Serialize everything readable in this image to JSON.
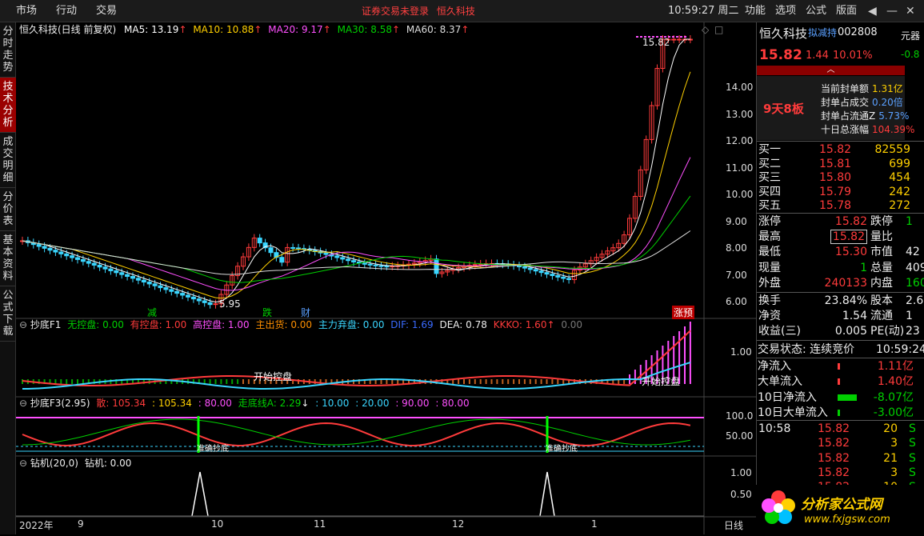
{
  "menu": {
    "market": "市场",
    "action": "行动",
    "trade": "交易"
  },
  "notice": {
    "login": "证券交易未登录",
    "stock": "恒久科技"
  },
  "clock": "10:59:27 周二",
  "right_menu": {
    "func": "功能",
    "option": "选项",
    "formula": "公式",
    "layout": "版面"
  },
  "left_tabs": [
    "分时走势",
    "技术分析",
    "成交明细",
    "分价表",
    "基本资料",
    "公式下载"
  ],
  "main_title": "恒久科技(日线 前复权)",
  "ma": [
    {
      "label": "MA5: 13.19",
      "color": "#ffffff"
    },
    {
      "label": "MA10: 10.88",
      "color": "#ffd000"
    },
    {
      "label": "MA20: 9.17",
      "color": "#ff50ff"
    },
    {
      "label": "MA30: 8.58",
      "color": "#00d000"
    },
    {
      "label": "MA60: 8.37",
      "color": "#dddddd"
    }
  ],
  "price_axis": [
    "14.00",
    "13.00",
    "12.00",
    "11.00",
    "10.00",
    "9.00",
    "8.00",
    "7.00",
    "6.00"
  ],
  "price_marks": {
    "high": "15.82",
    "low": "5.95",
    "tags": [
      "减",
      "跌",
      "财"
    ],
    "right_tag": "涨预"
  },
  "ind1": {
    "title": "抄底F1",
    "items": [
      {
        "label": "无控盘: 0.00",
        "color": "#00d000"
      },
      {
        "label": "有控盘: 1.00",
        "color": "#ff3b3b"
      },
      {
        "label": "高控盘: 1.00",
        "color": "#ff50ff"
      },
      {
        "label": "主出货: 0.00",
        "color": "#ff9000"
      },
      {
        "label": "主力弃盘: 0.00",
        "color": "#3ad6ff"
      },
      {
        "label": "DIF: 1.69",
        "color": "#3a6bff"
      },
      {
        "label": "DEA: 0.78",
        "color": "#eeeeee"
      },
      {
        "label": "KKKO: 1.60",
        "color": "#ff3b3b"
      },
      {
        "label": "0.00",
        "color": "#777777"
      }
    ],
    "axis": "1.00",
    "annot1": "开始控盘",
    "annot2": "开始控盘"
  },
  "ind2": {
    "title": "抄底F3(2.95)",
    "items": [
      {
        "label": "散: 105.34",
        "color": "#ff3b3b"
      },
      {
        "label": ": 105.34",
        "color": "#ffd000"
      },
      {
        "label": ": 80.00",
        "color": "#ff50ff"
      },
      {
        "label": "走底线A: 2.29",
        "color": "#00d000"
      },
      {
        "label": ": 10.00",
        "color": "#3ad6ff"
      },
      {
        "label": ": 20.00",
        "color": "#3ad6ff"
      },
      {
        "label": ": 90.00",
        "color": "#ff50ff"
      },
      {
        "label": ": 80.00",
        "color": "#ff50ff"
      }
    ],
    "axis": [
      "100.0",
      "50.00"
    ],
    "annot": "准确抄底"
  },
  "ind3": {
    "title": "钻机(20,0)",
    "value": "钻机: 0.00",
    "axis": [
      "1.00",
      "0.50"
    ]
  },
  "date_axis": [
    "2022年",
    "9",
    "10",
    "11",
    "12",
    "1"
  ],
  "period": "日线",
  "quote": {
    "name": "恒久科技",
    "tag": "拟减持",
    "code": "002808",
    "price": "15.82",
    "change": "1.44",
    "pct": "10.01%",
    "side_label": "元器",
    "side_value": "-0.8",
    "board": "9天8板",
    "stats": [
      {
        "k": "当前封单额",
        "v": "1.31亿",
        "c": "#ffd000"
      },
      {
        "k": "封单占成交",
        "v": "0.20倍",
        "c": "#5aa0ff"
      },
      {
        "k": "封单占流通Z",
        "v": "5.73%",
        "c": "#5aa0ff"
      },
      {
        "k": "十日总涨幅",
        "v": "104.39%",
        "c": "#ff3b3b"
      }
    ],
    "buy": [
      {
        "k": "买一",
        "p": "15.82",
        "v": "82559"
      },
      {
        "k": "买二",
        "p": "15.81",
        "v": "699"
      },
      {
        "k": "买三",
        "p": "15.80",
        "v": "454"
      },
      {
        "k": "买四",
        "p": "15.79",
        "v": "242"
      },
      {
        "k": "买五",
        "p": "15.78",
        "v": "272"
      }
    ],
    "info": [
      {
        "k1": "涨停",
        "v1": "15.82",
        "k2": "跌停",
        "v2": "1"
      },
      {
        "k1": "最高",
        "v1": "15.82",
        "k2": "量比",
        "v2": ""
      },
      {
        "k1": "最低",
        "v1": "15.30",
        "k2": "市值",
        "v2": "42"
      },
      {
        "k1": "现量",
        "v1": "1",
        "k2": "总量",
        "v2": "409"
      },
      {
        "k1": "外盘",
        "v1": "240133",
        "k2": "内盘",
        "v2": "160"
      }
    ],
    "info2": [
      {
        "k1": "换手",
        "v1": "23.84%",
        "k2": "股本",
        "v2": "2.6"
      },
      {
        "k1": "净资",
        "v1": "1.54",
        "k2": "流通",
        "v2": "1"
      },
      {
        "k1": "收益(三)",
        "v1": "0.005",
        "k2": "PE(动)",
        "v2": "23"
      }
    ],
    "status_label": "交易状态: 连续竞价",
    "status_time": "10:59:24",
    "flows": [
      {
        "k": "净流入",
        "v": "1.11亿",
        "c": "#ff3b3b"
      },
      {
        "k": "大单流入",
        "v": "1.40亿",
        "c": "#ff3b3b"
      },
      {
        "k": "10日净流入",
        "v": "-8.07亿",
        "c": "#00d000"
      },
      {
        "k": "10日大单流入",
        "v": "-3.00亿",
        "c": "#00d000"
      }
    ],
    "ticks": [
      {
        "t": "10:58",
        "p": "15.82",
        "v": "20",
        "s": "S"
      },
      {
        "t": "",
        "p": "15.82",
        "v": "3",
        "s": "S"
      },
      {
        "t": "",
        "p": "15.82",
        "v": "21",
        "s": "S"
      },
      {
        "t": "",
        "p": "15.82",
        "v": "3",
        "s": "S"
      },
      {
        "t": "",
        "p": "15.82",
        "v": "10",
        "s": "S"
      }
    ]
  },
  "watermark": {
    "name": "分析家公式网",
    "url": "www.fxjgsw.com"
  },
  "colors": {
    "up": "#ff3b3b",
    "down": "#3ad6ff",
    "ma5": "#ffffff",
    "ma10": "#ffd000",
    "ma20": "#ff50ff",
    "ma30": "#00d000",
    "ma60": "#dddddd"
  }
}
